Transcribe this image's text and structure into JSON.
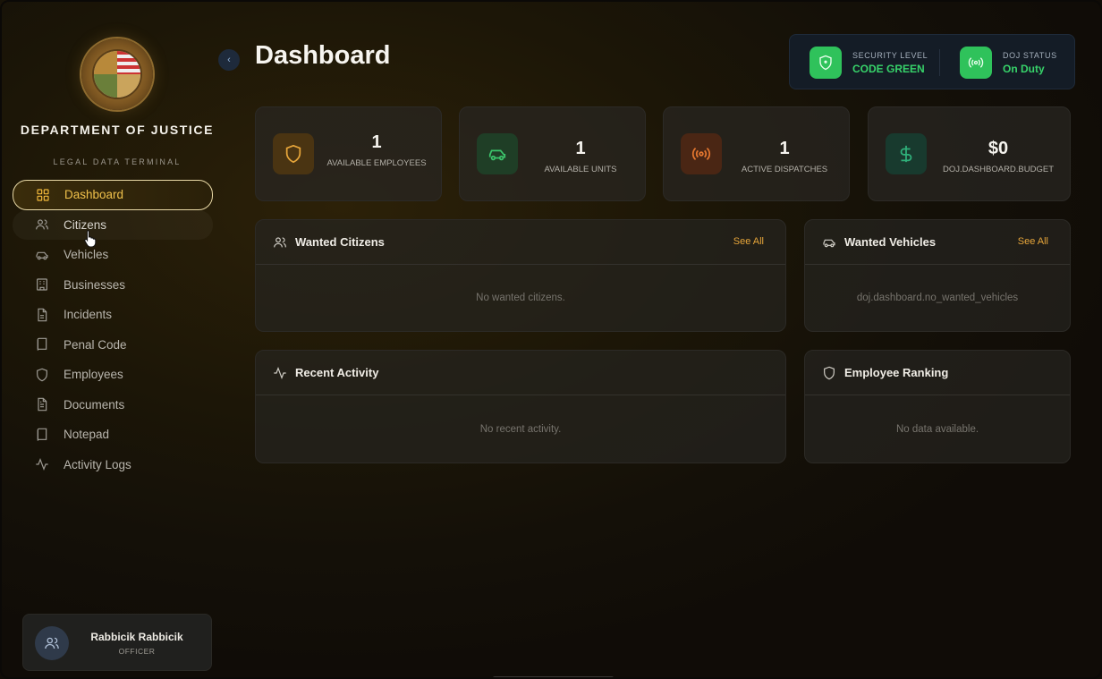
{
  "sidebar": {
    "title": "DEPARTMENT OF JUSTICE",
    "subtitle": "LEGAL DATA TERMINAL",
    "items": [
      {
        "label": "Dashboard",
        "icon": "grid-icon"
      },
      {
        "label": "Citizens",
        "icon": "users-icon"
      },
      {
        "label": "Vehicles",
        "icon": "car-icon"
      },
      {
        "label": "Businesses",
        "icon": "building-icon"
      },
      {
        "label": "Incidents",
        "icon": "file-icon"
      },
      {
        "label": "Penal Code",
        "icon": "book-icon"
      },
      {
        "label": "Employees",
        "icon": "shield-icon"
      },
      {
        "label": "Documents",
        "icon": "document-icon"
      },
      {
        "label": "Notepad",
        "icon": "notebook-icon"
      },
      {
        "label": "Activity Logs",
        "icon": "activity-icon"
      }
    ],
    "active_index": 0,
    "user": {
      "name": "Rabbicik Rabbicik",
      "role": "OFFICER"
    }
  },
  "header": {
    "title": "Dashboard",
    "security": {
      "label": "SECURITY LEVEL",
      "value": "CODE GREEN"
    },
    "doj_status": {
      "label": "DOJ STATUS",
      "value": "On Duty"
    }
  },
  "stats": [
    {
      "value": "1",
      "label": "AVAILABLE EMPLOYEES",
      "icon": "shield-icon",
      "color": "#e6a53a"
    },
    {
      "value": "1",
      "label": "AVAILABLE UNITS",
      "icon": "car-icon",
      "color": "#3cc46b"
    },
    {
      "value": "1",
      "label": "ACTIVE DISPATCHES",
      "icon": "broadcast-icon",
      "color": "#e3762f"
    },
    {
      "value": "$0",
      "label": "DOJ.DASHBOARD.BUDGET",
      "icon": "dollar-icon",
      "color": "#2fb07a"
    }
  ],
  "panels": {
    "wanted_citizens": {
      "title": "Wanted Citizens",
      "link": "See All",
      "empty": "No wanted citizens."
    },
    "wanted_vehicles": {
      "title": "Wanted Vehicles",
      "link": "See All",
      "empty": "doj.dashboard.no_wanted_vehicles"
    },
    "recent_activity": {
      "title": "Recent Activity",
      "empty": "No recent activity."
    },
    "employee_ranking": {
      "title": "Employee Ranking",
      "empty": "No data available."
    }
  },
  "colors": {
    "accent": "#f0b83a",
    "success": "#2fc25b",
    "link": "#e6a53a"
  }
}
